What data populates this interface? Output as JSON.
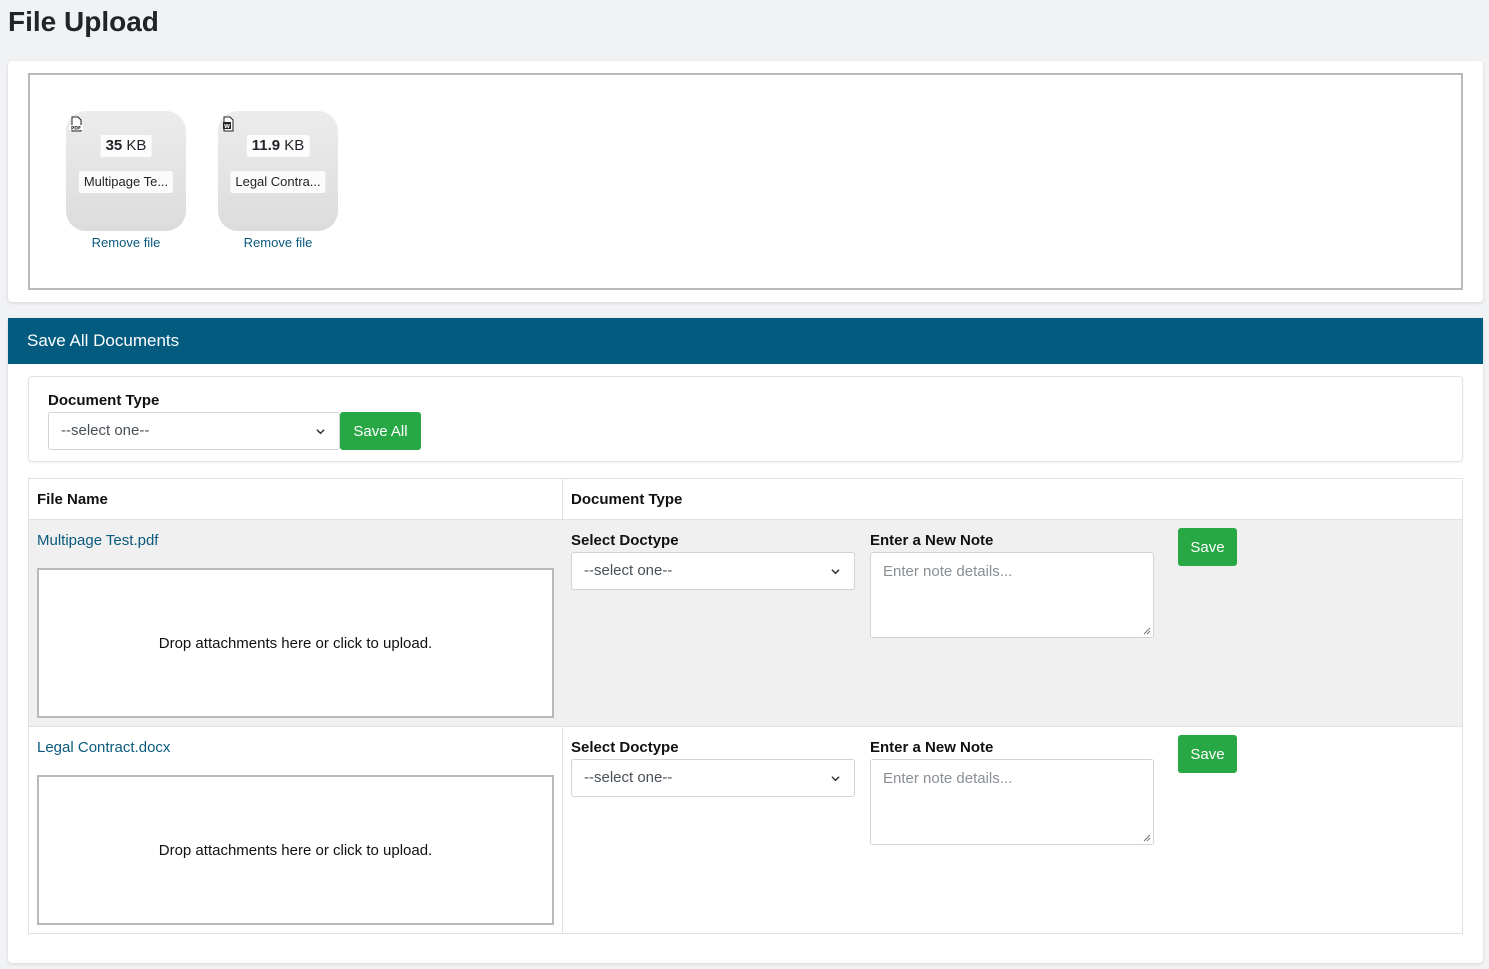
{
  "page": {
    "title": "File Upload"
  },
  "uploads": [
    {
      "icon": "pdf-file-icon",
      "size_value": "35",
      "size_unit": "KB",
      "name": "Multipage Te...",
      "remove_label": "Remove file"
    },
    {
      "icon": "word-file-icon",
      "size_value": "11.9",
      "size_unit": "KB",
      "name": "Legal Contra...",
      "remove_label": "Remove file"
    }
  ],
  "save_all": {
    "header": "Save All Documents",
    "doc_type_label": "Document Type",
    "select_value": "--select one--",
    "button_label": "Save All"
  },
  "table": {
    "headers": {
      "file_name": "File Name",
      "document_type": "Document Type"
    },
    "rows": [
      {
        "file_name": "Multipage Test.pdf",
        "drop_text": "Drop attachments here or click to upload.",
        "doctype_label": "Select Doctype",
        "doctype_value": "--select one--",
        "note_label": "Enter a New Note",
        "note_placeholder": "Enter note details...",
        "save_label": "Save"
      },
      {
        "file_name": "Legal Contract.docx",
        "drop_text": "Drop attachments here or click to upload.",
        "doctype_label": "Select Doctype",
        "doctype_value": "--select one--",
        "note_label": "Enter a New Note",
        "note_placeholder": "Enter note details...",
        "save_label": "Save"
      }
    ]
  },
  "colors": {
    "header_bg": "#035b80",
    "button_green": "#28a745",
    "link": "#0b5a7d",
    "row_shade": "#f0f0f0"
  }
}
